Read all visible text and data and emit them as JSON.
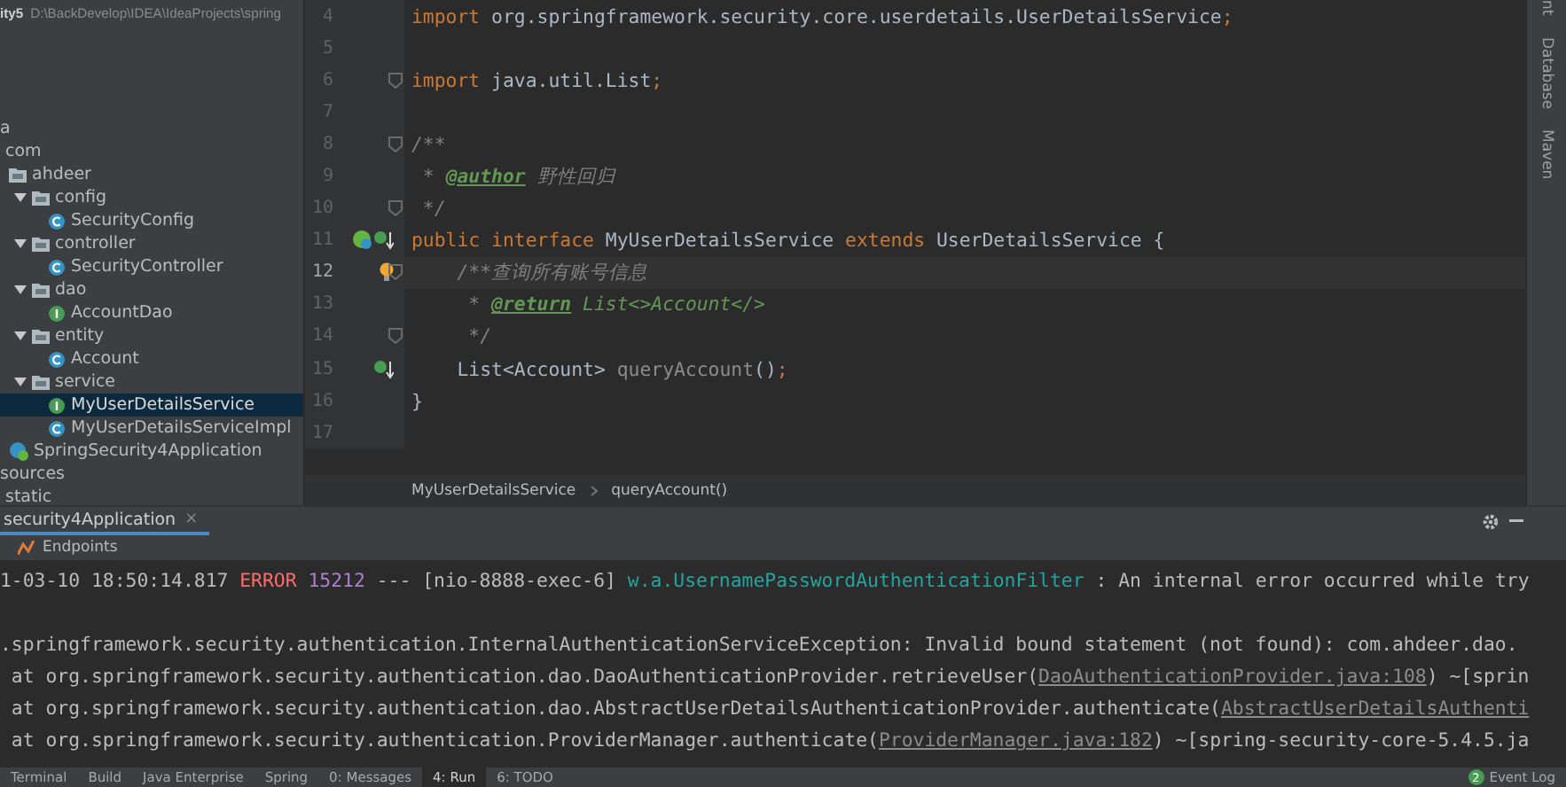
{
  "project": {
    "name": "ity5",
    "path": "D:\\BackDevelop\\IDEA\\IdeaProjects\\spring"
  },
  "tree": [
    {
      "label": "a",
      "selected": false,
      "children": [
        {
          "label": "com",
          "selected": false,
          "children": [
            {
              "label": "ahdeer",
              "kind": "folder",
              "selected": false,
              "children": [
                {
                  "label": "config",
                  "kind": "folder",
                  "expanded": true,
                  "selected": false,
                  "children": [
                    {
                      "label": "SecurityConfig",
                      "kind": "class",
                      "selected": false
                    }
                  ]
                },
                {
                  "label": "controller",
                  "kind": "folder",
                  "expanded": true,
                  "selected": false,
                  "children": [
                    {
                      "label": "SecurityController",
                      "kind": "class",
                      "selected": false
                    }
                  ]
                },
                {
                  "label": "dao",
                  "kind": "folder",
                  "expanded": true,
                  "selected": false,
                  "children": [
                    {
                      "label": "AccountDao",
                      "kind": "interface",
                      "selected": false
                    }
                  ]
                },
                {
                  "label": "entity",
                  "kind": "folder",
                  "expanded": true,
                  "selected": false,
                  "children": [
                    {
                      "label": "Account",
                      "kind": "class",
                      "selected": false
                    }
                  ]
                },
                {
                  "label": "service",
                  "kind": "folder",
                  "expanded": true,
                  "selected": false,
                  "children": [
                    {
                      "label": "MyUserDetailsService",
                      "kind": "interface",
                      "selected": true
                    },
                    {
                      "label": "MyUserDetailsServiceImpl",
                      "kind": "class",
                      "selected": false
                    }
                  ]
                }
              ]
            },
            {
              "label": "SpringSecurity4Application",
              "kind": "app",
              "selected": false
            }
          ]
        }
      ]
    },
    {
      "label": "sources",
      "selected": false,
      "children": [
        {
          "label": "static",
          "selected": false
        }
      ]
    }
  ],
  "editor": {
    "lines": [
      {
        "number": "4",
        "fold": false,
        "current": false,
        "segments": [
          {
            "kind": "keyword",
            "text": "import "
          },
          {
            "kind": "plain",
            "text": "org.springframework.security.core.userdetails.UserDetailsService"
          },
          {
            "kind": "keyword",
            "text": ";"
          }
        ]
      },
      {
        "number": "5",
        "fold": false,
        "current": false
      },
      {
        "number": "6",
        "fold": true,
        "current": false,
        "segments": [
          {
            "kind": "keyword",
            "text": "import "
          },
          {
            "kind": "plain",
            "text": "java.util.List"
          },
          {
            "kind": "keyword",
            "text": ";"
          }
        ]
      },
      {
        "number": "7",
        "fold": false,
        "current": false
      },
      {
        "number": "8",
        "fold": true,
        "current": false,
        "segments": [
          {
            "kind": "comment",
            "text": "/**"
          }
        ]
      },
      {
        "number": "9",
        "fold": false,
        "current": false,
        "segments": [
          {
            "kind": "comment",
            "text": " * "
          },
          {
            "kind": "doctag",
            "text": "@author"
          },
          {
            "kind": "comment",
            "text": " 野性回归"
          }
        ]
      },
      {
        "number": "10",
        "fold": true,
        "current": false,
        "segments": [
          {
            "kind": "comment",
            "text": " */"
          }
        ]
      },
      {
        "number": "11",
        "fold": false,
        "current": false,
        "markers": [
          {
            "kind": "bean"
          },
          {
            "kind": "implemented"
          }
        ],
        "segments": [
          {
            "kind": "keyword",
            "text": "public interface "
          },
          {
            "kind": "plain",
            "text": "MyUserDetailsService "
          },
          {
            "kind": "keyword",
            "text": "extends "
          },
          {
            "kind": "plain",
            "text": "UserDetailsService {"
          }
        ]
      },
      {
        "number": "12",
        "fold": true,
        "current": true,
        "markers": [
          {
            "kind": "bulb"
          }
        ],
        "segments": [
          {
            "kind": "comment",
            "text": "    /**查询所有账号信息"
          }
        ]
      },
      {
        "number": "13",
        "fold": false,
        "current": false,
        "segments": [
          {
            "kind": "comment",
            "text": "     * "
          },
          {
            "kind": "doctag",
            "text": "@return"
          },
          {
            "kind": "doctext",
            "text": " List<>Account</>"
          }
        ]
      },
      {
        "number": "14",
        "fold": true,
        "current": false,
        "segments": [
          {
            "kind": "comment",
            "text": "     */"
          }
        ]
      },
      {
        "number": "15",
        "fold": false,
        "current": false,
        "markers": [
          {
            "kind": "implemented"
          }
        ],
        "segments": [
          {
            "kind": "plain",
            "text": "    List<Account> "
          },
          {
            "kind": "unused",
            "text": "queryAccount"
          },
          {
            "kind": "plain",
            "text": "()"
          },
          {
            "kind": "keyword",
            "text": ";"
          }
        ]
      },
      {
        "number": "16",
        "fold": false,
        "current": false,
        "segments": [
          {
            "kind": "plain",
            "text": "}"
          }
        ]
      },
      {
        "number": "17",
        "fold": false,
        "current": false
      }
    ],
    "breadcrumbs": [
      "MyUserDetailsService",
      "queryAccount()"
    ]
  },
  "side_tools": [
    "nt",
    "Database",
    "Maven"
  ],
  "run": {
    "tab": "security4Application",
    "close": "×",
    "toolbar": "Endpoints",
    "console": [
      {
        "gap_after": true,
        "segments": [
          {
            "kind": "plain",
            "text": "1-03-10 18:50:14.817 "
          },
          {
            "kind": "error",
            "text": "ERROR"
          },
          {
            "kind": "pid",
            "text": " 15212"
          },
          {
            "kind": "plain",
            "text": " --- [nio-8888-exec-6] "
          },
          {
            "kind": "logger",
            "text": "w.a.UsernamePasswordAuthenticationFilter"
          },
          {
            "kind": "plain",
            "text": " : An internal error occurred while try"
          }
        ]
      },
      {
        "gap_after": false,
        "segments": [
          {
            "kind": "plain",
            "text": ".springframework.security.authentication.InternalAuthenticationServiceException: Invalid bound statement (not found): com.ahdeer.dao."
          }
        ]
      },
      {
        "gap_after": false,
        "segments": [
          {
            "kind": "plain",
            "text": " at org.springframework.security.authentication.dao.DaoAuthenticationProvider.retrieveUser("
          },
          {
            "kind": "link",
            "text": "DaoAuthenticationProvider.java:108"
          },
          {
            "kind": "plain",
            "text": ") ~[sprin"
          }
        ]
      },
      {
        "gap_after": false,
        "segments": [
          {
            "kind": "plain",
            "text": " at org.springframework.security.authentication.dao.AbstractUserDetailsAuthenticationProvider.authenticate("
          },
          {
            "kind": "link",
            "text": "AbstractUserDetailsAuthenti"
          }
        ]
      },
      {
        "gap_after": false,
        "segments": [
          {
            "kind": "plain",
            "text": " at org.springframework.security.authentication.ProviderManager.authenticate("
          },
          {
            "kind": "link",
            "text": "ProviderManager.java:182"
          },
          {
            "kind": "plain",
            "text": ") ~[spring-security-core-5.4.5.ja"
          }
        ]
      }
    ]
  },
  "bottom_tabs": [
    {
      "label": "Terminal",
      "selected": false
    },
    {
      "label": "Build",
      "selected": false
    },
    {
      "label": "Java Enterprise",
      "selected": false
    },
    {
      "label": "Spring",
      "selected": false
    },
    {
      "label": "0: Messages",
      "selected": false
    },
    {
      "label": "4: Run",
      "selected": true
    },
    {
      "label": "6: TODO",
      "selected": false
    }
  ],
  "event_log": {
    "label": "Event Log",
    "count": "2"
  }
}
